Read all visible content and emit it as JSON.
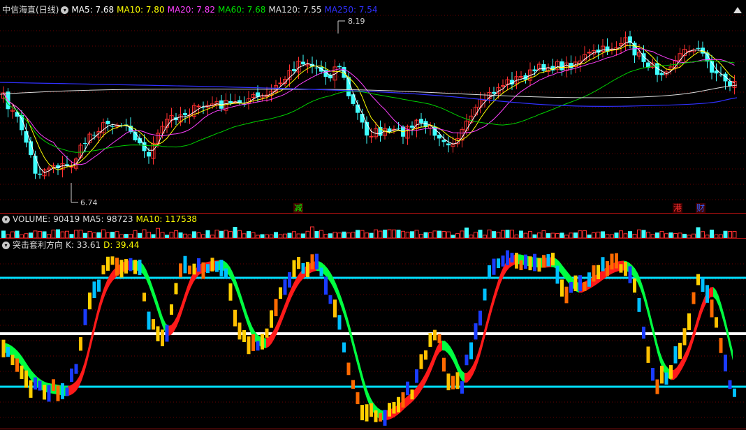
{
  "main": {
    "stock_name": "中信海直",
    "period": "(日线)",
    "ma_labels": [
      {
        "text": "MA5: 7.68",
        "color": "#ffffff"
      },
      {
        "text": "MA10: 7.80",
        "color": "#ffff00"
      },
      {
        "text": "MA20: 7.82",
        "color": "#ff40ff"
      },
      {
        "text": "MA60: 7.68",
        "color": "#00e000"
      },
      {
        "text": "MA120: 7.55",
        "color": "#dddddd"
      },
      {
        "text": "MA250: 7.54",
        "color": "#3030ff"
      }
    ],
    "high_label": "8.19",
    "low_label": "6.74",
    "tags": [
      {
        "text": "减",
        "color": "#00ff00"
      },
      {
        "text": "港",
        "color": "#ff3030"
      },
      {
        "text": "财",
        "color": "#3060ff"
      }
    ]
  },
  "volume": {
    "title": "VOLUME: 90419",
    "ma5": "MA5: 98723",
    "ma10": "MA10: 117538",
    "colors": {
      "title": "#dddddd",
      "ma5": "#dddddd",
      "ma10": "#ffff00"
    }
  },
  "indicator": {
    "title": "突击套利方向",
    "k": "K: 33.61",
    "d": "D: 39.44",
    "colors": {
      "k": "#dddddd",
      "d": "#ffff00"
    }
  },
  "chart_data": [
    {
      "type": "candlestick",
      "title": "中信海直 (日线)",
      "annotations": [
        "8.19",
        "6.74"
      ],
      "series": [
        {
          "name": "MA5",
          "last": 7.68
        },
        {
          "name": "MA10",
          "last": 7.8
        },
        {
          "name": "MA20",
          "last": 7.82
        },
        {
          "name": "MA60",
          "last": 7.68
        },
        {
          "name": "MA120",
          "last": 7.55
        },
        {
          "name": "MA250",
          "last": 7.54
        }
      ],
      "ylim": [
        6.74,
        8.19
      ]
    },
    {
      "type": "bar",
      "title": "VOLUME",
      "series": [
        {
          "name": "VOLUME",
          "last": 90419
        },
        {
          "name": "MA5",
          "last": 98723
        },
        {
          "name": "MA10",
          "last": 117538
        }
      ]
    },
    {
      "type": "line",
      "title": "突击套利方向",
      "series": [
        {
          "name": "K",
          "last": 33.61
        },
        {
          "name": "D",
          "last": 39.44
        }
      ]
    }
  ]
}
